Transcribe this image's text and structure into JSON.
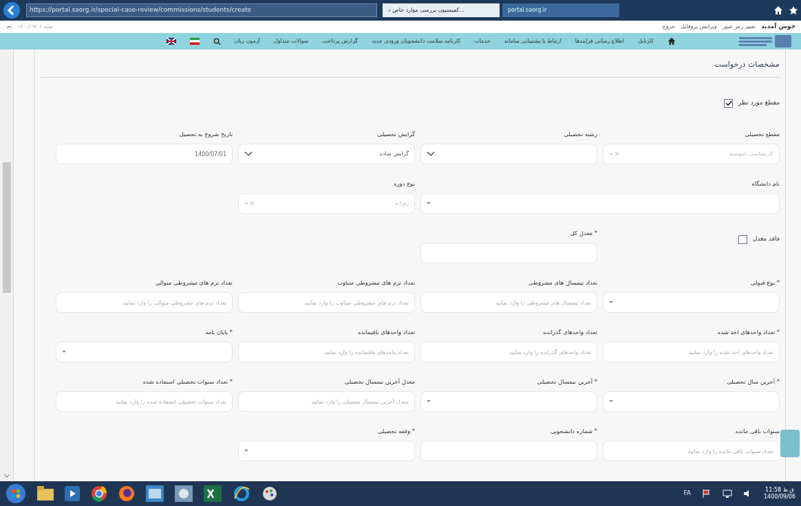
{
  "browser": {
    "address": "https://portal.saorg.ir/special-case-review/commissions/students/create",
    "tabs": [
      {
        "label": "portal.saorg.ir",
        "selected": false
      },
      {
        "label": "کمیسیون بررسی موارد خاص د...",
        "selected": true
      }
    ]
  },
  "top_bar": {
    "date_note": "شنبه ۱۴۰۰/۰۹/۰۶",
    "links": [
      "خوش آمدید",
      "تغییر رمز عبور",
      "ویرایش پروفایل",
      "خروج"
    ]
  },
  "nav": {
    "items": [
      "کارتابل",
      "اطلاع رسانی فرایندها",
      "ارتباط با پشتیبانی سامانه",
      "خدمات",
      "کارنامه سلامت دانشجویان ورودی جدید",
      "گزارش پرداخت",
      "سوالات متداول",
      "آزمون زبان"
    ]
  },
  "section_title": "مشخصات درخواست",
  "rows": [
    [
      {
        "kind": "checkbox",
        "label": "مقطع مورد نظر",
        "checked": true
      }
    ],
    [
      {
        "kind": "combo",
        "label": "مقطع تحصیلی",
        "placeholder": "کارشناسی ناپیوسته"
      },
      {
        "kind": "dropdown",
        "label": "رشته تحصیلی"
      },
      {
        "kind": "dropdown",
        "label": "گرایش تحصیلی",
        "value": "گرایش ساده"
      },
      {
        "kind": "input",
        "label": "تاریخ شروع به تحصیل",
        "value": "1400/07/01"
      }
    ],
    [
      {
        "kind": "combo",
        "label": "نام دانشگاه",
        "wide": true
      },
      {
        "kind": "combo",
        "label": "نوع دوره",
        "placeholder": "روزانه"
      }
    ],
    [
      {
        "kind": "checkbox",
        "label": "فاقد معدل",
        "checked": false
      },
      {
        "kind": "input",
        "label": "* معدل کل"
      }
    ],
    [
      {
        "kind": "combo",
        "label": "* نوع قبولی"
      },
      {
        "kind": "input",
        "label": "تعداد نیمسال های مشروطی",
        "placeholder": "تعداد نیمسال های مشروطی را وارد نمایید"
      },
      {
        "kind": "input",
        "label": "تعداد ترم های مشروطی متناوب",
        "placeholder": "تعداد ترم های مشروطی متناوب را وارد نمایید"
      },
      {
        "kind": "input",
        "label": "تعداد ترم های مشروطی متوالی",
        "placeholder": "تعداد ترم های مشروطی متوالی را وارد نمایید"
      }
    ],
    [
      {
        "kind": "input",
        "label": "* تعداد واحدهای اخذ شده",
        "placeholder": "تعداد واحدهای اخذ شده را وارد نمایید"
      },
      {
        "kind": "input",
        "label": "تعداد واحدهای گذرانده",
        "placeholder": "تعداد واحدهای گذرانده را وارد نمایید"
      },
      {
        "kind": "input",
        "label": "تعداد واحدهای باقیمانده",
        "placeholder": "تعداد واحدهای باقیمانده را وارد نمایید"
      },
      {
        "kind": "combo",
        "label": "* پایان نامه"
      }
    ],
    [
      {
        "kind": "combo",
        "label": "* آخرین سال تحصیلی"
      },
      {
        "kind": "combo",
        "label": "* آخرین نیمسال تحصیلی"
      },
      {
        "kind": "input",
        "label": "معدل آخرین نیمسال تحصیلی",
        "placeholder": "معدل آخرین نیمسال تحصیلی را وارد نمایید"
      },
      {
        "kind": "input",
        "label": "* تعداد سنوات تحصیلی استفاده شده",
        "placeholder": "تعداد سنوات تحصیلی استفاده شده را وارد نمایید"
      }
    ],
    [
      {
        "kind": "input",
        "label": "سنوات باقی مانده",
        "placeholder": "تعداد سنوات باقی مانده را وارد نمایید"
      },
      {
        "kind": "input",
        "label": "* شماره دانشجویی"
      },
      {
        "kind": "combo",
        "label": "* وقفه تحصیلی"
      }
    ]
  ],
  "taskbar": {
    "language": "FA",
    "time": "11:58 ق.ظ",
    "date": "1400/09/06"
  }
}
